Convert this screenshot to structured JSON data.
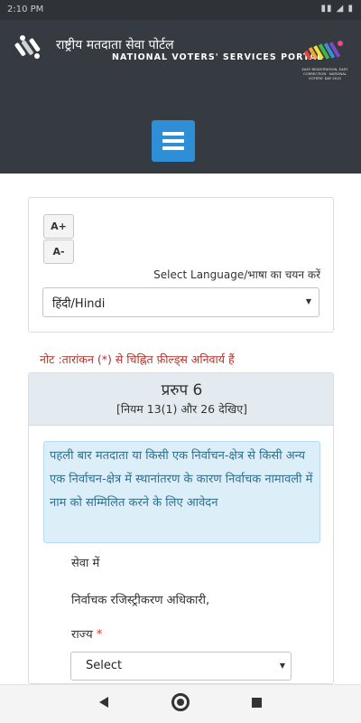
{
  "status_bar": {
    "time": "2:10 PM",
    "indicators": "▮▮ ◢ ▮"
  },
  "header": {
    "title_hindi": "राष्ट्रीय मतदाता सेवा पोर्टल",
    "title_english": "NATIONAL VOTERS' SERVICES PORTAL",
    "logo_right_text": "EASY REGISTRATION, EASY CORRECTION · NATIONAL VOTERS' DAY 2015",
    "accent_color": "#2f8fd6",
    "background_color": "#353b40"
  },
  "menu_button": {
    "icon": "hamburger-menu-icon"
  },
  "language_panel": {
    "font_increase_label": "A+",
    "font_decrease_label": "A-",
    "select_label": "Select Language/भाषा का चयन करें",
    "selected_language": "हिंदी/Hindi"
  },
  "note": "नोट :तारांकन (*) से चिह्नित फ़ील्ड्स अनिवार्य हैं",
  "form": {
    "title": "प्ररुप 6",
    "subtitle": "[नियम 13(1) और 26 देखिए]",
    "info_text": "पहली बार मतदाता या किसी एक निर्वाचन-क्षेत्र से किसी अन्य एक निर्वाचन-क्षेत्र में स्थानांतरण के कारण निर्वाचक नामावली में नाम को सम्मिलित करने के लिए आवेदन",
    "to_label": "सेवा में",
    "officer_label": "निर्वाचक रजिस्ट्रीकरण अधिकारी,",
    "state_label": "राज्य",
    "required_marker": "*",
    "state_value": "Select"
  },
  "nav_bar": {
    "back_icon": "back-triangle-icon",
    "home_icon": "home-circle-icon",
    "recents_icon": "recents-square-icon"
  }
}
